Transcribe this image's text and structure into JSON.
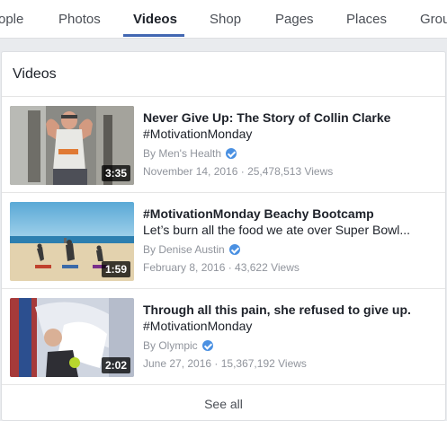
{
  "tabs": [
    {
      "label": "ople"
    },
    {
      "label": "Photos"
    },
    {
      "label": "Videos"
    },
    {
      "label": "Shop"
    },
    {
      "label": "Pages"
    },
    {
      "label": "Places"
    },
    {
      "label": "Grou"
    }
  ],
  "active_tab": "Videos",
  "section": {
    "title": "Videos",
    "see_all": "See all"
  },
  "videos": [
    {
      "title": "Never Give Up: The Story of Collin Clarke",
      "subtitle": "#MotivationMonday",
      "author": "By Men's Health",
      "meta": "November 14, 2016 · 25,478,513 Views",
      "duration": "3:35"
    },
    {
      "title": "#MotivationMonday Beachy Bootcamp",
      "subtitle": "Let’s burn all the food we ate over Super Bowl...",
      "author": "By Denise Austin",
      "meta": "February 8, 2016 · 43,622 Views",
      "duration": "1:59"
    },
    {
      "title": "Through all this pain, she refused to give up.",
      "subtitle": "#MotivationMonday",
      "author": "By Olympic",
      "meta": "June 27, 2016 · 15,367,192 Views",
      "duration": "2:02"
    }
  ],
  "colors": {
    "accent": "#4267b2",
    "verified": "#4a90e2"
  }
}
